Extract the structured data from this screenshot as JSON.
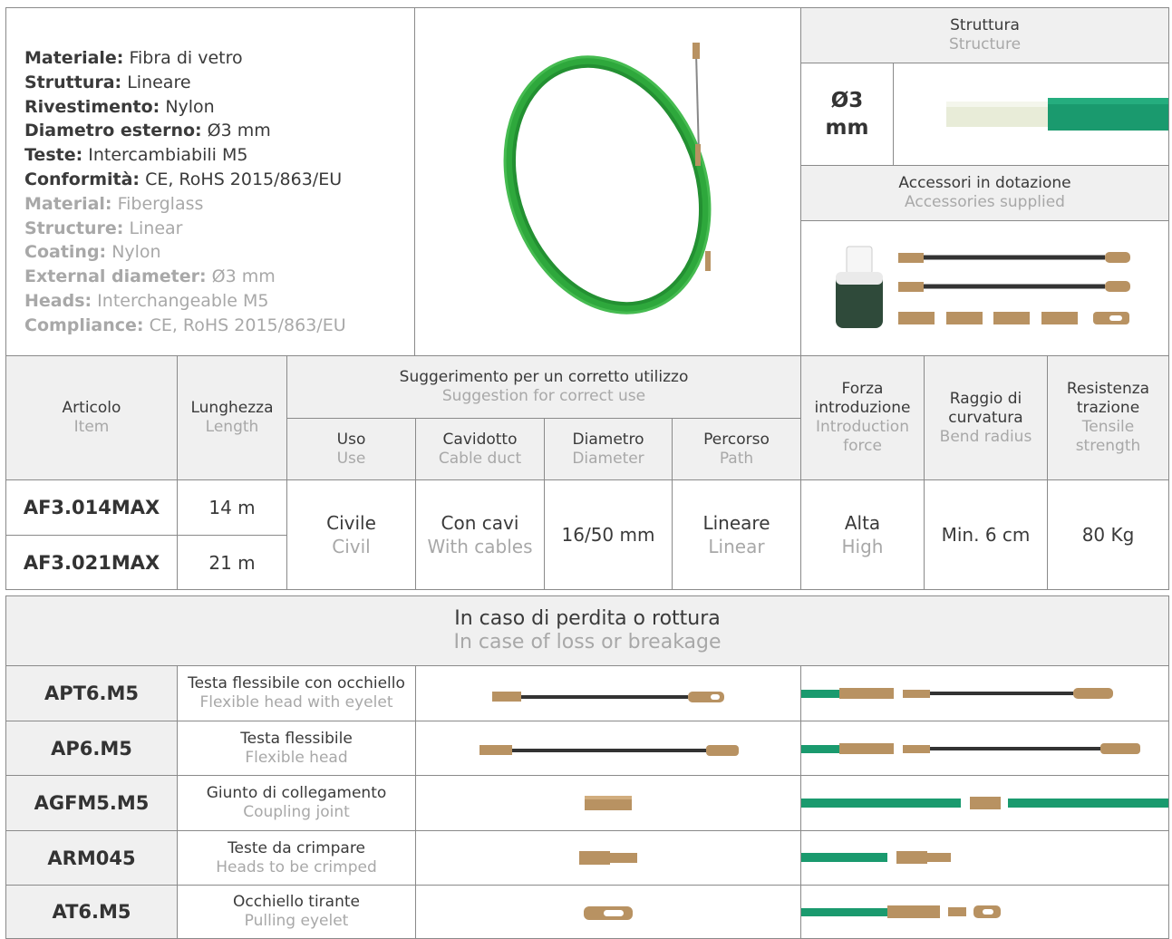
{
  "specs": {
    "italian": [
      {
        "label": "Materiale:",
        "value": "Fibra di vetro"
      },
      {
        "label": "Struttura:",
        "value": "Lineare"
      },
      {
        "label": "Rivestimento:",
        "value": "Nylon"
      },
      {
        "label": "Diametro esterno:",
        "value": "Ø3 mm"
      },
      {
        "label": "Teste:",
        "value": "Intercambiabili M5"
      },
      {
        "label": "Conformità:",
        "value": "CE, RoHS 2015/863/EU"
      }
    ],
    "english": [
      {
        "label": "Material:",
        "value": "Fiberglass"
      },
      {
        "label": "Structure:",
        "value": "Linear"
      },
      {
        "label": "Coating:",
        "value": "Nylon"
      },
      {
        "label": "External diameter:",
        "value": "Ø3 mm"
      },
      {
        "label": "Heads:",
        "value": "Interchangeable M5"
      },
      {
        "label": "Compliance:",
        "value": "CE, RoHS 2015/863/EU"
      }
    ]
  },
  "structure": {
    "header_it": "Struttura",
    "header_en": "Structure",
    "diameter": "Ø3 mm"
  },
  "accessories": {
    "header_it": "Accessori in dotazione",
    "header_en": "Accessories supplied"
  },
  "table": {
    "headers": {
      "item_it": "Articolo",
      "item_en": "Item",
      "length_it": "Lunghezza",
      "length_en": "Length",
      "suggestion_it": "Suggerimento per un corretto utilizzo",
      "suggestion_en": "Suggestion for correct use",
      "use_it": "Uso",
      "use_en": "Use",
      "duct_it": "Cavidotto",
      "duct_en": "Cable duct",
      "diameter_it": "Diametro",
      "diameter_en": "Diameter",
      "path_it": "Percorso",
      "path_en": "Path",
      "force_it": "Forza introduzione",
      "force_en": "Introduction force",
      "bend_it": "Raggio di curvatura",
      "bend_en": "Bend radius",
      "tensile_it": "Resistenza trazione",
      "tensile_en": "Tensile strength"
    },
    "rows": [
      {
        "code": "AF3.014MAX",
        "length": "14 m"
      },
      {
        "code": "AF3.021MAX",
        "length": "21 m"
      }
    ],
    "shared": {
      "use_it": "Civile",
      "use_en": "Civil",
      "duct_it": "Con cavi",
      "duct_en": "With cables",
      "diameter": "16/50 mm",
      "path_it": "Lineare",
      "path_en": "Linear",
      "force_it": "Alta",
      "force_en": "High",
      "bend": "Min. 6 cm",
      "tensile": "80 Kg"
    }
  },
  "loss": {
    "title_it": "In caso di perdita o rottura",
    "title_en": "In case of loss or breakage",
    "rows": [
      {
        "code": "APT6.M5",
        "desc_it": "Testa flessibile con occhiello",
        "desc_en": "Flexible head with eyelet"
      },
      {
        "code": "AP6.M5",
        "desc_it": "Testa flessibile",
        "desc_en": "Flexible head"
      },
      {
        "code": "AGFM5.M5",
        "desc_it": "Giunto di collegamento",
        "desc_en": "Coupling joint"
      },
      {
        "code": "ARM045",
        "desc_it": "Teste da crimpare",
        "desc_en": "Heads to be crimped"
      },
      {
        "code": "AT6.M5",
        "desc_it": "Occhiello tirante",
        "desc_en": "Pulling eyelet"
      }
    ]
  },
  "colors": {
    "green": "#2ea83c",
    "teal": "#1a9a6e",
    "brass": "#b89262",
    "cream": "#e8ecd8"
  }
}
